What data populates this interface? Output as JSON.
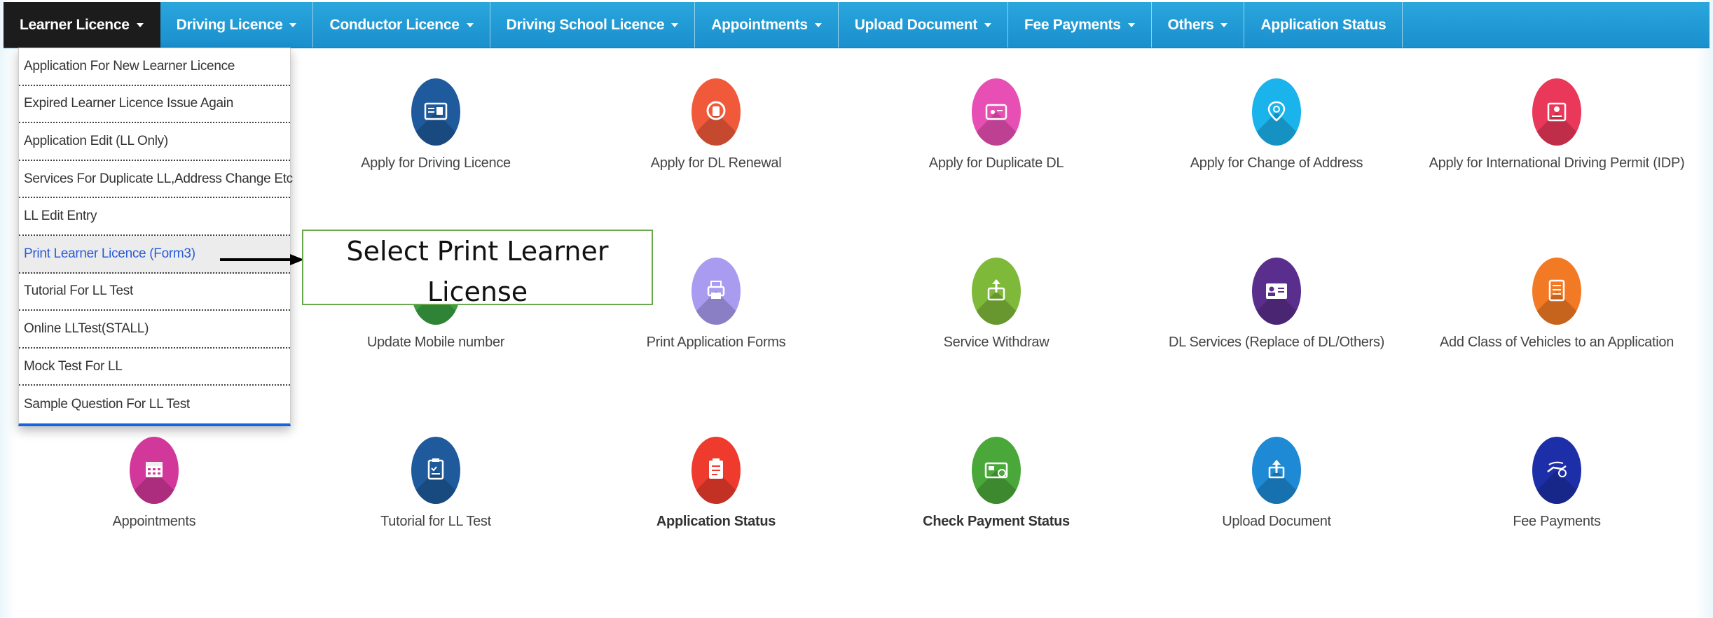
{
  "nav": {
    "items": [
      {
        "label": "Learner Licence",
        "dropdown": true
      },
      {
        "label": "Driving Licence",
        "dropdown": true
      },
      {
        "label": "Conductor Licence",
        "dropdown": true
      },
      {
        "label": "Driving School Licence",
        "dropdown": true
      },
      {
        "label": "Appointments",
        "dropdown": true
      },
      {
        "label": "Upload Document",
        "dropdown": true
      },
      {
        "label": "Fee Payments",
        "dropdown": true
      },
      {
        "label": "Others",
        "dropdown": true
      },
      {
        "label": "Application Status",
        "dropdown": false
      }
    ],
    "bar_color": "#1a8fcd",
    "active_color": "#1c1c1c"
  },
  "dropdown": {
    "items": [
      "Application For New Learner Licence",
      "Expired Learner Licence Issue Again",
      "Application Edit (LL Only)",
      "Services For Duplicate LL,Address Change Etc",
      "LL Edit Entry",
      "Print Learner Licence (Form3)",
      "Tutorial For LL Test",
      "Online LLTest(STALL)",
      "Mock Test For LL",
      "Sample Question For LL Test"
    ],
    "highlighted": "Print Learner Licence (Form3)",
    "highlight_color": "#2a5bd7"
  },
  "tiles": [
    {
      "label": "Apply for Driving Licence",
      "icon": "id-card-icon",
      "color": "#1f5b9c"
    },
    {
      "label": "Apply for DL Renewal",
      "icon": "renewal-icon",
      "color": "#f05a3a"
    },
    {
      "label": "Apply for Duplicate DL",
      "icon": "duplicate-card-icon",
      "color": "#e84fb4"
    },
    {
      "label": "Apply for Change of Address",
      "icon": "map-pin-icon",
      "color": "#1ab3ec"
    },
    {
      "label": "Apply for International Driving Permit (IDP)",
      "icon": "permit-icon",
      "color": "#e9385a"
    },
    {
      "label": "Update Mobile number",
      "icon": "mobile-icon",
      "color": "#3aa043"
    },
    {
      "label": "Print Application Forms",
      "icon": "printer-icon",
      "color": "#a99cf0"
    },
    {
      "label": "Service Withdraw",
      "icon": "withdraw-icon",
      "color": "#7fb93a"
    },
    {
      "label": "DL Services (Replace of DL/Others)",
      "icon": "contact-card-icon",
      "color": "#5a2e8c"
    },
    {
      "label": "Add Class of Vehicles to an Application",
      "icon": "checklist-icon",
      "color": "#f27a25"
    },
    {
      "label": "Appointments",
      "icon": "calendar-icon",
      "color": "#d2379a"
    },
    {
      "label": "Tutorial for LL Test",
      "icon": "clipboard-icon",
      "color": "#1f5b9c"
    },
    {
      "label": "Application Status",
      "icon": "status-clipboard-icon",
      "color": "#ee3b2d"
    },
    {
      "label": "Check Payment Status",
      "icon": "payment-card-icon",
      "color": "#4aa83a"
    },
    {
      "label": "Upload Document",
      "icon": "upload-icon",
      "color": "#1e8ad6"
    },
    {
      "label": "Fee Payments",
      "icon": "fee-hand-icon",
      "color": "#1d2fa8"
    }
  ],
  "callout": {
    "text": "Select Print Learner License",
    "border_color": "#6aa84f"
  }
}
